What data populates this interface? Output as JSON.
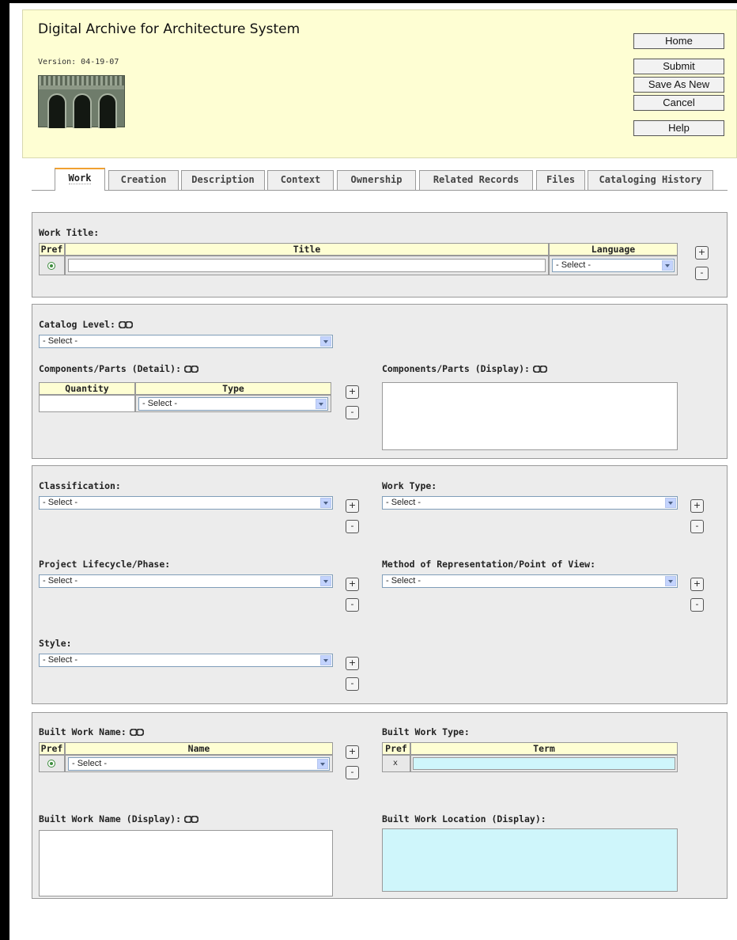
{
  "header": {
    "app_title": "Digital Archive for Architecture System",
    "version": "Version: 04-19-07",
    "buttons": {
      "home": "Home",
      "submit": "Submit",
      "save_as_new": "Save As New",
      "cancel": "Cancel",
      "help": "Help"
    }
  },
  "tabs": [
    "Work",
    "Creation",
    "Description",
    "Context",
    "Ownership",
    "Related Records",
    "Files",
    "Cataloging History"
  ],
  "active_tab": "Work",
  "common": {
    "select_placeholder": "- Select -",
    "add": "+",
    "remove": "-",
    "clear": "x"
  },
  "work_title": {
    "label": "Work Title:",
    "col_pref": "Pref",
    "col_title": "Title",
    "col_language": "Language",
    "title_value": "",
    "language_value": "- Select -"
  },
  "catalog": {
    "catalog_level_label": "Catalog Level:",
    "catalog_level_value": "- Select -",
    "components_detail_label": "Components/Parts (Detail):",
    "col_quantity": "Quantity",
    "col_type": "Type",
    "quantity_value": "",
    "type_value": "- Select -",
    "components_display_label": "Components/Parts (Display):",
    "components_display_value": ""
  },
  "classification": {
    "classification_label": "Classification:",
    "classification_value": "- Select -",
    "work_type_label": "Work Type:",
    "work_type_value": "- Select -",
    "project_lifecycle_label": "Project Lifecycle/Phase:",
    "project_lifecycle_value": "- Select -",
    "method_label": "Method of Representation/Point of View:",
    "method_value": "- Select -",
    "style_label": "Style:",
    "style_value": "- Select -"
  },
  "built_work": {
    "name_label": "Built Work Name:",
    "col_pref": "Pref",
    "col_name": "Name",
    "name_value": "- Select -",
    "type_label": "Built Work Type:",
    "col_term": "Term",
    "term_value": "",
    "name_display_label": "Built Work Name (Display):",
    "name_display_value": "",
    "location_display_label": "Built Work Location (Display):",
    "location_display_value": ""
  },
  "colors": {
    "header_bg": "#fefed3",
    "section_bg": "#ececec",
    "tab_accent": "#f0a030",
    "cyan_field": "#cff6fb"
  },
  "icons": [
    "link-icon",
    "dropdown-arrow-icon",
    "radio-selected-icon",
    "arch-logo"
  ]
}
